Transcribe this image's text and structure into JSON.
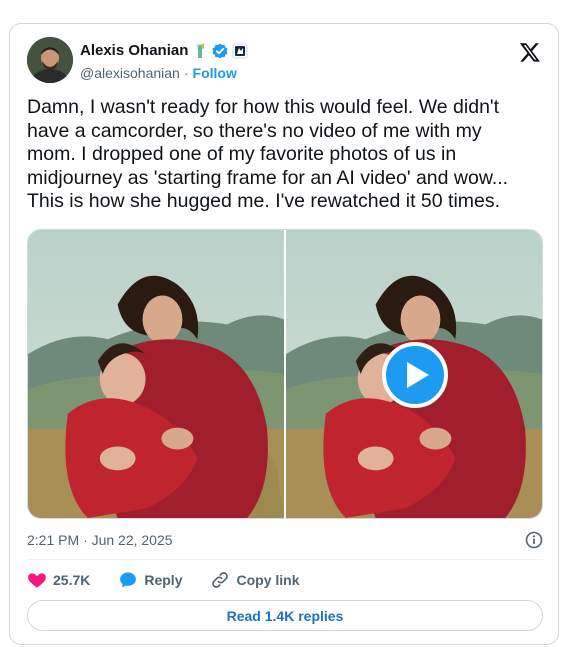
{
  "tweet": {
    "author": {
      "name": "Alexis Ohanian",
      "handle": "@alexisohanian",
      "separator": "·",
      "follow_label": "Follow"
    },
    "text": "Damn, I wasn't ready for how this would feel. We didn't\nhave a camcorder, so there's no video of me with my\nmom. I dropped one of my favorite photos of us in\nmidjourney as 'starting frame for an AI video' and wow...\nThis is how she hugged me. I've rewatched it 50 times.",
    "timestamp": "2:21 PM · Jun 22, 2025",
    "actions": {
      "likes_count": "25.7K",
      "reply_label": "Reply",
      "copy_link_label": "Copy link"
    },
    "read_replies_label": "Read 1.4K replies"
  },
  "icons": {
    "badges": [
      "statue-of-liberty-emoji",
      "verified-badge",
      "affiliate-badge"
    ],
    "brand": "x-logo",
    "info": "info-icon",
    "like": "heart-icon",
    "reply": "speech-bubble-icon",
    "copy": "link-icon",
    "play": "play-icon"
  },
  "colors": {
    "accent": "#1d9bf0",
    "like": "#f91880",
    "text_primary": "#0f1419",
    "text_secondary": "#536471",
    "border": "#cfd9de"
  }
}
